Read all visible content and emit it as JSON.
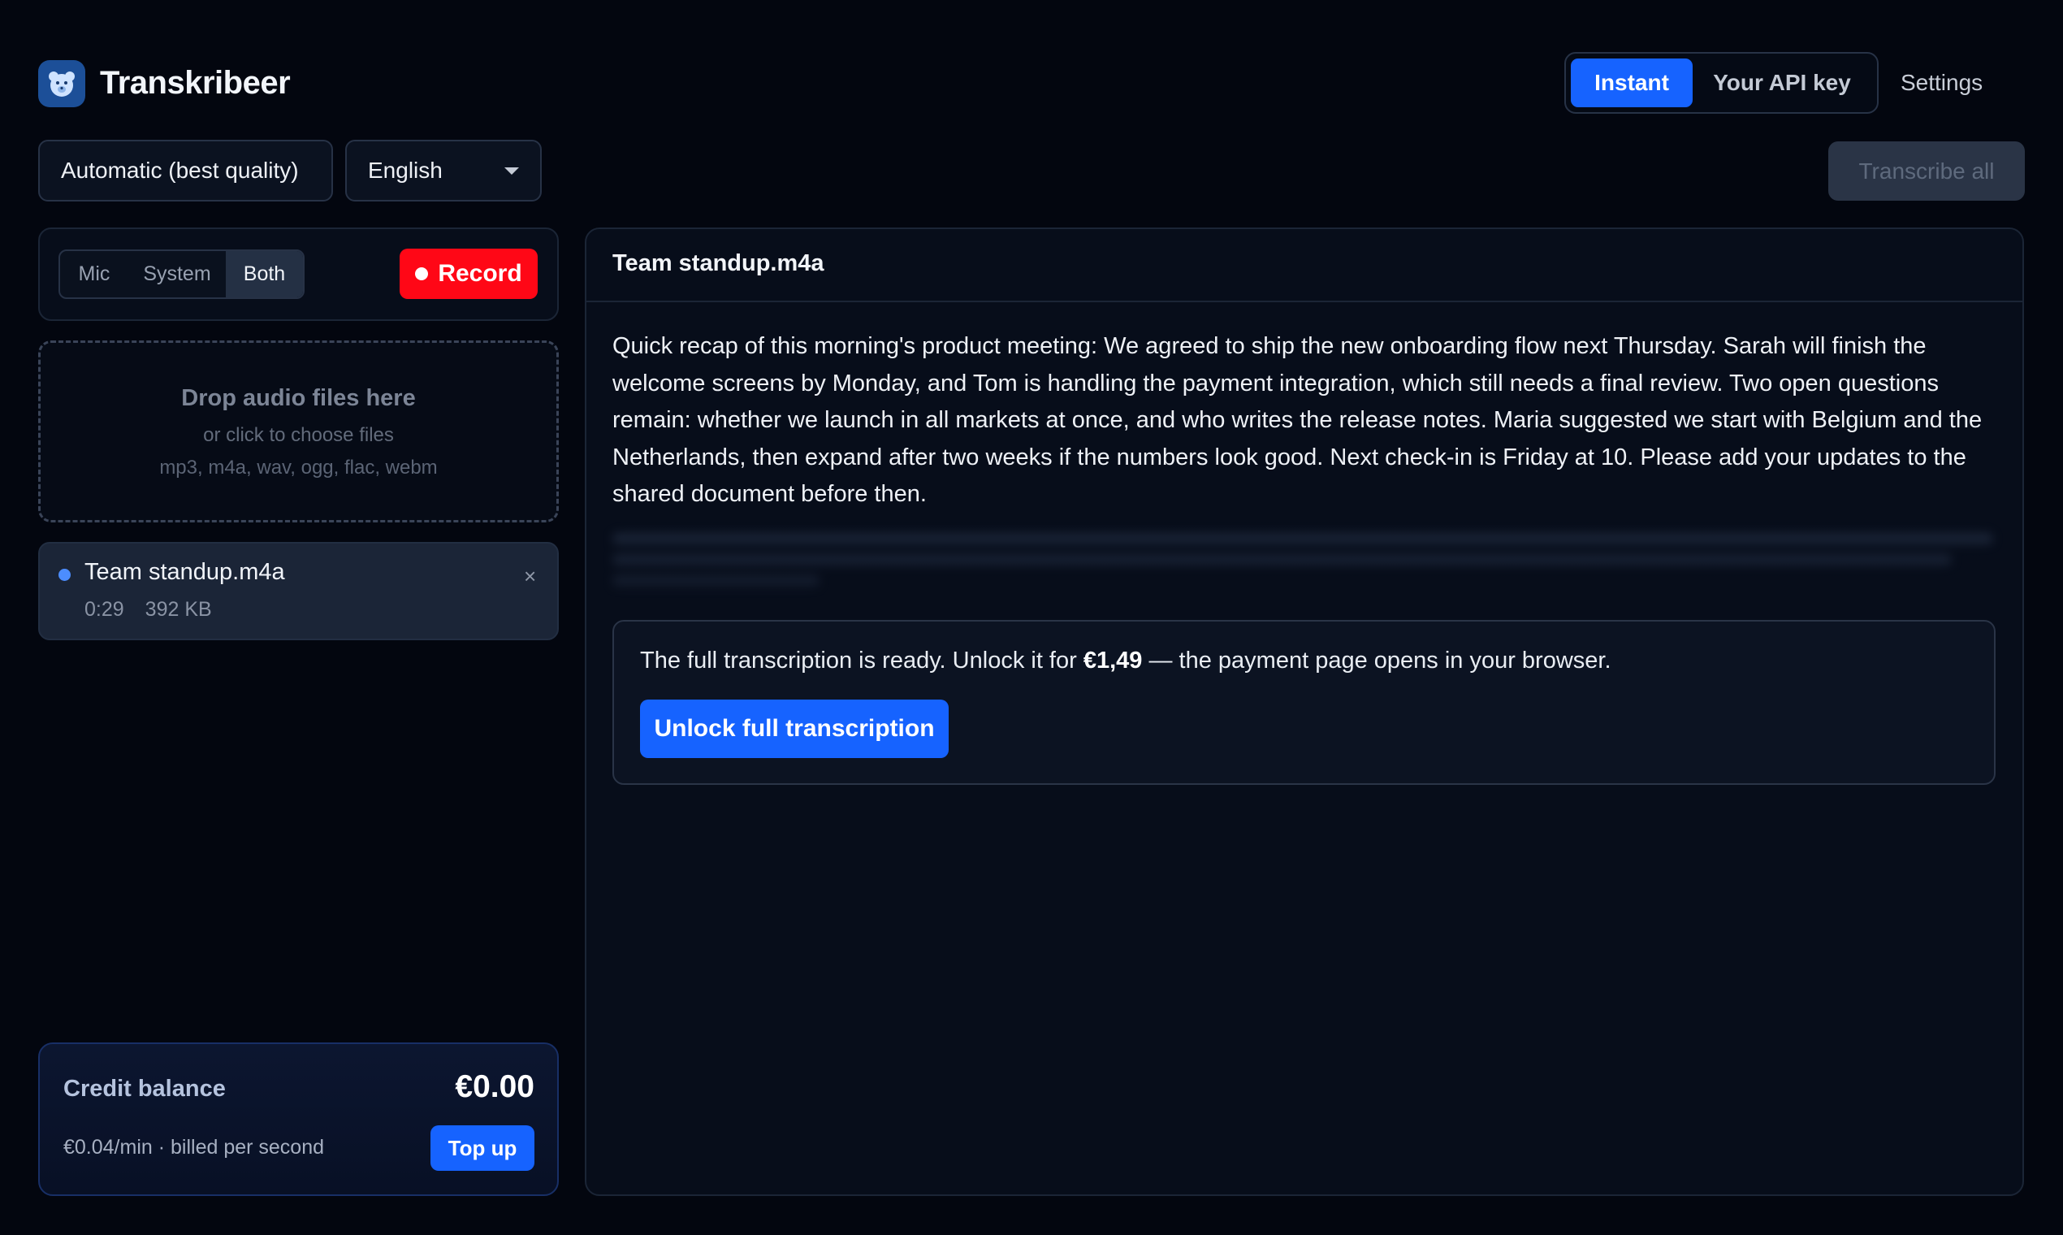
{
  "app": {
    "title": "Transkribeer",
    "logo_icon": "bear-icon"
  },
  "header": {
    "mode_tabs": [
      {
        "label": "Instant",
        "active": true
      },
      {
        "label": "Your API key",
        "active": false
      }
    ],
    "settings_label": "Settings"
  },
  "toolbar": {
    "quality_value": "Automatic (best quality)",
    "language_value": "English",
    "transcribe_all_label": "Transcribe all",
    "transcribe_all_disabled": true
  },
  "recorder": {
    "sources": [
      {
        "label": "Mic",
        "active": false
      },
      {
        "label": "System",
        "active": false
      },
      {
        "label": "Both",
        "active": true
      }
    ],
    "record_label": "Record"
  },
  "dropzone": {
    "title": "Drop audio files here",
    "subtitle": "or click to choose files",
    "types": "mp3, m4a, wav, ogg, flac, webm"
  },
  "files": [
    {
      "name": "Team standup.m4a",
      "duration": "0:29",
      "size": "392 KB",
      "close": "×"
    }
  ],
  "credit": {
    "label": "Credit balance",
    "amount": "€0.00",
    "rate": "€0.04/min · billed per second",
    "topup_label": "Top up"
  },
  "main": {
    "file_title": "Team standup.m4a",
    "transcript": "Quick recap of this morning's product meeting: We agreed to ship the new onboarding flow next Thursday. Sarah will finish the welcome screens by Monday, and Tom is handling the payment integration, which still needs a final review. Two open questions remain: whether we launch in all markets at once, and who writes the release notes. Maria suggested we start with Belgium and the Netherlands, then expand after two weeks if the numbers look good. Next check-in is Friday at 10. Please add your updates to the shared document before then.",
    "unlock": {
      "text_before": "The full transcription is ready. Unlock it for ",
      "price": "€1,49",
      "text_after": " — the payment page opens in your browser.",
      "button_label": "Unlock full transcription"
    }
  },
  "colors": {
    "background": "#03060f",
    "accent": "#1663ff",
    "record": "#ff0716"
  }
}
